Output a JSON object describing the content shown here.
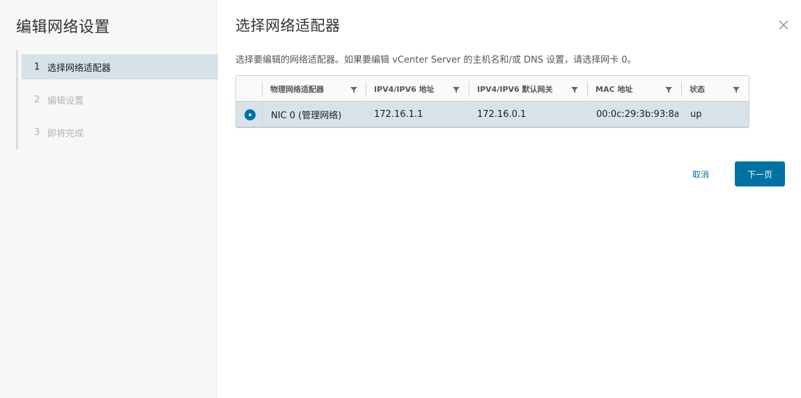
{
  "sidebar": {
    "title": "编辑网络设置",
    "steps": [
      {
        "num": "1",
        "label": "选择网络适配器",
        "state": "active"
      },
      {
        "num": "2",
        "label": "编辑设置",
        "state": "disabled"
      },
      {
        "num": "3",
        "label": "即将完成",
        "state": "disabled"
      }
    ]
  },
  "main": {
    "title": "选择网络适配器",
    "description": "选择要编辑的网络适配器。如果要编辑 vCenter Server 的主机名和/或 DNS 设置，请选择网卡 0。"
  },
  "table": {
    "columns": [
      "物理网络适配器",
      "IPV4/IPV6 地址",
      "IPV4/IPV6 默认网关",
      "MAC 地址",
      "状态"
    ],
    "rows": [
      {
        "selected": true,
        "adapter": "NIC 0 (管理网络)",
        "ip": "172.16.1.1",
        "gateway": "172.16.0.1",
        "mac": "00:0c:29:3b:93:8a",
        "status": "up"
      }
    ]
  },
  "footer": {
    "cancel_label": "取消",
    "next_label": "下一页"
  },
  "icons": {
    "close": "close-icon",
    "filter": "filter-icon",
    "radio": "radio-selected-icon"
  },
  "colors": {
    "accent": "#0072a3",
    "active_step_bg": "#d6e1e8",
    "selected_row_bg": "#d8e3e9",
    "sidebar_bg": "#f7f7f7"
  }
}
